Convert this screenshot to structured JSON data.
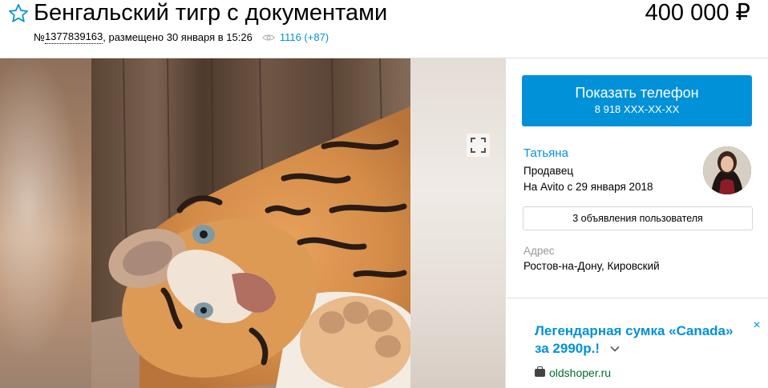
{
  "listing": {
    "title": "Бенгальский тигр с документами",
    "price": "400 000 ₽",
    "id_prefix": "№ ",
    "id": "1377839163",
    "posted": ", размещено 30 января в 15:26",
    "views": "1116 (+87)"
  },
  "seller": {
    "phone_label": "Показать телефон",
    "phone_masked": "8 918 XXX-XX-XX",
    "name": "Татьяна",
    "role": "Продавец",
    "since": "На Avito с 29 января 2018",
    "ads_button": "3 объявления пользователя",
    "address_label": "Адрес",
    "address": "Ростов-на-Дону, Кировский"
  },
  "ad": {
    "title": "Легендарная сумка «Canada» за 2990р.!",
    "close": "×",
    "domain": "oldshoper.ru"
  },
  "colors": {
    "accent": "#0091d9",
    "ad_domain": "#046c33",
    "muted": "#999999"
  },
  "icons": [
    "star-outline-icon",
    "eye-icon",
    "fullscreen-icon",
    "chevron-down-icon",
    "close-icon",
    "bag-icon"
  ]
}
